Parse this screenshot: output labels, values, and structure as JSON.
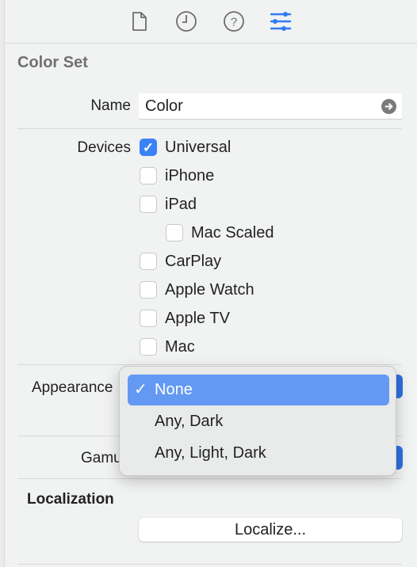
{
  "toolbar": {
    "icons": [
      "file-icon",
      "history-clock-icon",
      "help-icon",
      "attributes-sliders-icon"
    ],
    "active_color": "#2f7bf5"
  },
  "section_title": "Color Set",
  "name": {
    "label": "Name",
    "value": "Color"
  },
  "devices": {
    "label": "Devices",
    "items": [
      {
        "label": "Universal",
        "checked": true
      },
      {
        "label": "iPhone",
        "checked": false
      },
      {
        "label": "iPad",
        "checked": false
      },
      {
        "label": "Mac Scaled",
        "checked": false
      },
      {
        "label": "CarPlay",
        "checked": false
      },
      {
        "label": "Apple Watch",
        "checked": false
      },
      {
        "label": "Apple TV",
        "checked": false
      },
      {
        "label": "Mac",
        "checked": false
      }
    ]
  },
  "appearance": {
    "label": "Appearance",
    "options": [
      "None",
      "Any, Dark",
      "Any, Light, Dark"
    ],
    "selected": "None",
    "check": "✓"
  },
  "gamut": {
    "label": "Gamut"
  },
  "localization": {
    "title": "Localization",
    "button": "Localize..."
  }
}
